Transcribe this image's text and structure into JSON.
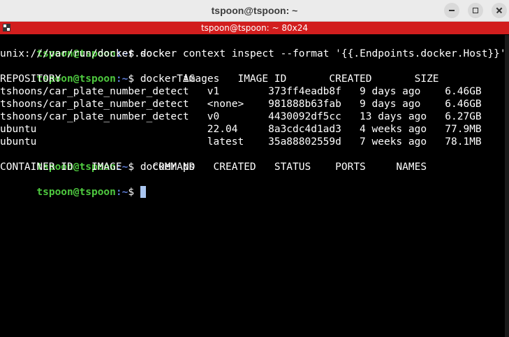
{
  "window": {
    "title": "tspoon@tspoon: ~",
    "tab_title": "tspoon@tspoon: ~ 80x24"
  },
  "prompt": {
    "user": "tspoon@tspoon",
    "path": ":~",
    "symbol": "$ "
  },
  "terminal": {
    "cmd1": "docker context inspect --format '{{.Endpoints.docker.Host}}'",
    "out1": "unix:///var/run/docker.sock",
    "cmd2": "docker images",
    "images_header": "REPOSITORY                   TAG       IMAGE ID       CREATED       SIZE",
    "images_rows": [
      "tshoons/car_plate_number_detect   v1        373ff4eadb8f   9 days ago    6.46GB",
      "tshoons/car_plate_number_detect   <none>    981888b63fab   9 days ago    6.46GB",
      "tshoons/car_plate_number_detect   v0        4430092df5cc   13 days ago   6.27GB",
      "ubuntu                            22.04     8a3cdc4d1ad3   4 weeks ago   77.9MB",
      "ubuntu                            latest    35a88802559d   7 weeks ago   78.1MB"
    ],
    "cmd3": "docker ps",
    "ps_header": "CONTAINER ID   IMAGE     COMMAND   CREATED   STATUS    PORTS     NAMES"
  },
  "colors": {
    "prompt_user": "#4ec93f",
    "prompt_path": "#5d7cd6",
    "tab_bar": "#d21e1e",
    "titlebar": "#ebebeb"
  }
}
